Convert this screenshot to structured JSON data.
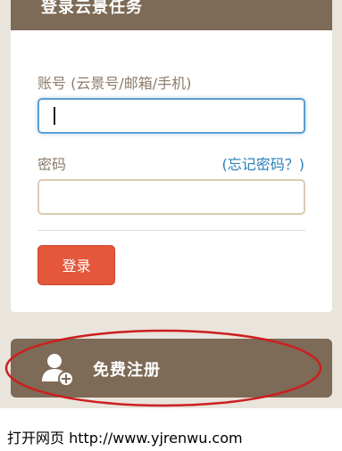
{
  "header": {
    "title": "登录云景任务"
  },
  "form": {
    "account_label": "账号 (云景号/邮箱/手机)",
    "password_label": "密码",
    "forgot_label": "(忘记密码？)",
    "login_label": "登录"
  },
  "register": {
    "label": "免费注册",
    "icon": "add-user-icon"
  },
  "caption": {
    "text": "打开网页 http://www.yjrenwu.com"
  },
  "colors": {
    "header_bg": "#7d6a57",
    "login_button": "#e4573a",
    "link": "#2b7fb8",
    "annotation": "#cc1f1f"
  }
}
